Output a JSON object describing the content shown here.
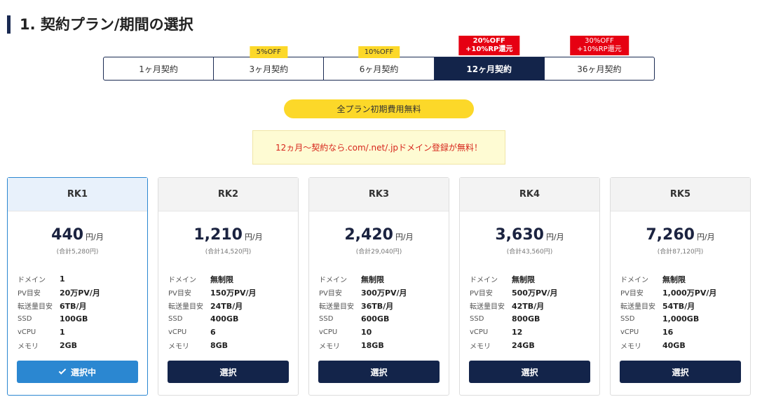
{
  "section_title": "1. 契約プラン/期間の選択",
  "tabs": [
    {
      "label": "1ヶ月契約",
      "badge": ""
    },
    {
      "label": "3ヶ月契約",
      "badge": "5%OFF"
    },
    {
      "label": "6ヶ月契約",
      "badge": "10%OFF"
    },
    {
      "label": "12ヶ月契約",
      "badge_line1": "20%OFF",
      "badge_line2": "+10%RP還元",
      "active": true
    },
    {
      "label": "36ヶ月契約",
      "badge_line1": "30%OFF",
      "badge_line2": "+10%RP還元"
    }
  ],
  "free_setup_label": "全プラン初期費用無料",
  "domain_notice": "12ヵ月〜契約なら.com/.net/.jpドメイン登録が無料！",
  "spec_labels": {
    "domain": "ドメイン",
    "pv": "PV目安",
    "transfer": "転送量目安",
    "ssd": "SSD",
    "vcpu": "vCPU",
    "memory": "メモリ"
  },
  "price_unit": "円/月",
  "plans": [
    {
      "name": "RK1",
      "price": "440",
      "total": "(合計5,280円)",
      "domain": "1",
      "pv": "20万PV/月",
      "transfer": "6TB/月",
      "ssd": "100GB",
      "vcpu": "1",
      "memory": "2GB",
      "button": "選択中",
      "selected": true
    },
    {
      "name": "RK2",
      "price": "1,210",
      "total": "(合計14,520円)",
      "domain": "無制限",
      "pv": "150万PV/月",
      "transfer": "24TB/月",
      "ssd": "400GB",
      "vcpu": "6",
      "memory": "8GB",
      "button": "選択"
    },
    {
      "name": "RK3",
      "price": "2,420",
      "total": "(合計29,040円)",
      "domain": "無制限",
      "pv": "300万PV/月",
      "transfer": "36TB/月",
      "ssd": "600GB",
      "vcpu": "10",
      "memory": "18GB",
      "button": "選択"
    },
    {
      "name": "RK4",
      "price": "3,630",
      "total": "(合計43,560円)",
      "domain": "無制限",
      "pv": "500万PV/月",
      "transfer": "42TB/月",
      "ssd": "800GB",
      "vcpu": "12",
      "memory": "24GB",
      "button": "選択"
    },
    {
      "name": "RK5",
      "price": "7,260",
      "total": "(合計87,120円)",
      "domain": "無制限",
      "pv": "1,000万PV/月",
      "transfer": "54TB/月",
      "ssd": "1,000GB",
      "vcpu": "16",
      "memory": "40GB",
      "button": "選択"
    }
  ],
  "colors": {
    "navy": "#13244a",
    "blue": "#2b87d1",
    "yellow": "#fcd829",
    "red": "#e60012",
    "notice_text": "#d7261c"
  }
}
